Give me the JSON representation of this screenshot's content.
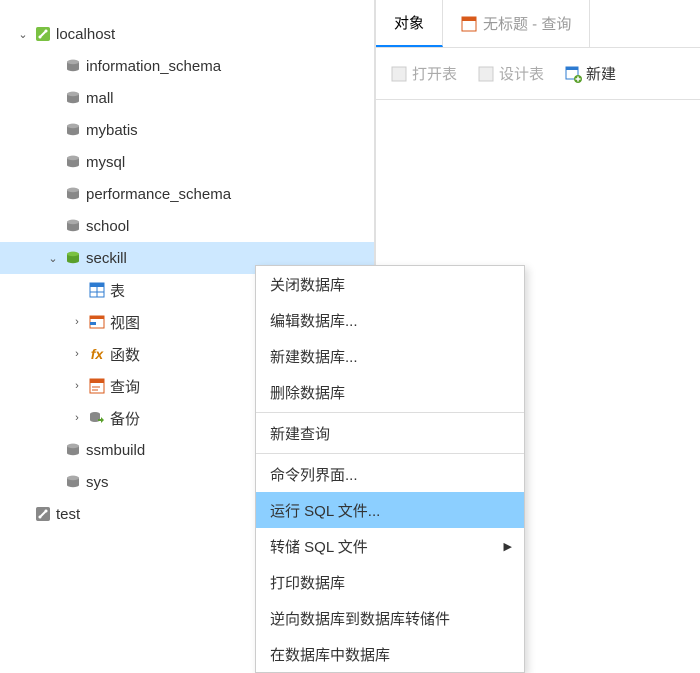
{
  "tree": {
    "connection": "localhost",
    "databases": [
      "information_schema",
      "mall",
      "mybatis",
      "mysql",
      "performance_schema",
      "school",
      "seckill",
      "ssmbuild",
      "sys"
    ],
    "selected_db": "seckill",
    "seckill_children": {
      "tables": "表",
      "views": "视图",
      "functions": "函数",
      "queries": "查询",
      "backups": "备份"
    },
    "second_connection": "test"
  },
  "right": {
    "tabs": {
      "active": "对象",
      "untitled": "无标题 - 查询"
    },
    "toolbar": {
      "open_table": "打开表",
      "design_table": "设计表",
      "new_table": "新建"
    }
  },
  "context_menu": {
    "items": [
      {
        "label": "关闭数据库",
        "type": "item"
      },
      {
        "label": "编辑数据库...",
        "type": "item"
      },
      {
        "label": "新建数据库...",
        "type": "item"
      },
      {
        "label": "删除数据库",
        "type": "item"
      },
      {
        "type": "sep"
      },
      {
        "label": "新建查询",
        "type": "item"
      },
      {
        "type": "sep"
      },
      {
        "label": "命令列界面...",
        "type": "item"
      },
      {
        "label": "运行 SQL 文件...",
        "type": "item",
        "highlight": true
      },
      {
        "label": "转储 SQL 文件",
        "type": "submenu"
      },
      {
        "label": "打印数据库",
        "type": "item"
      },
      {
        "label": "逆向数据库到数据库转储件",
        "type": "item"
      },
      {
        "label": "在数据库中数据库",
        "type": "item"
      }
    ]
  }
}
